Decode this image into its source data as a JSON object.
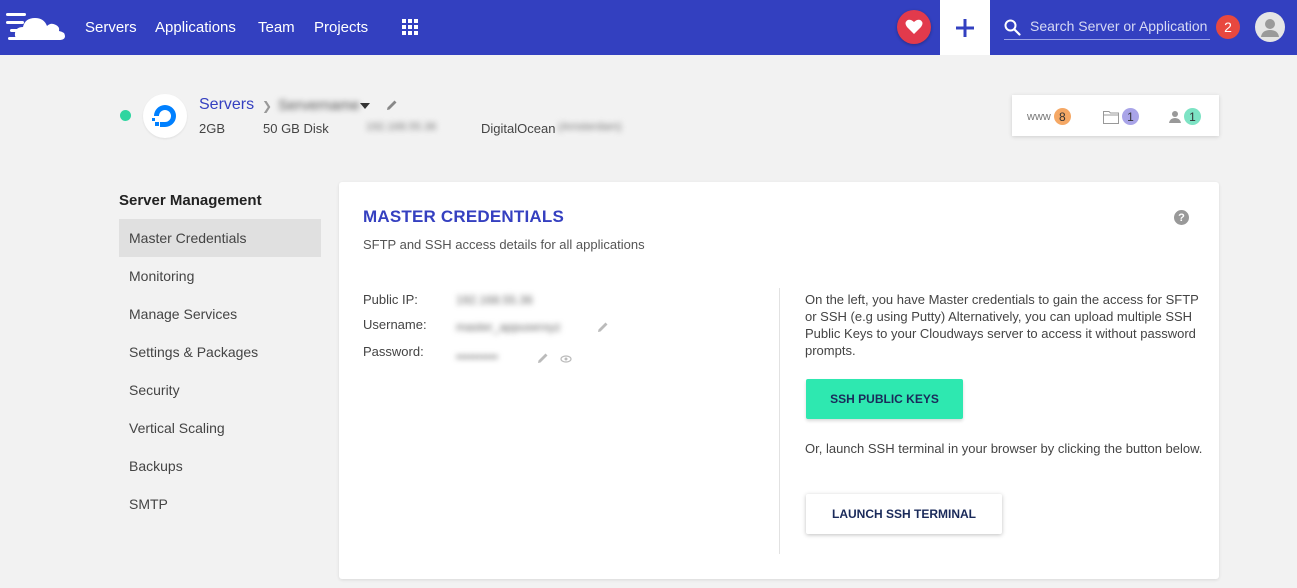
{
  "nav": {
    "items": [
      "Servers",
      "Applications",
      "Team",
      "Projects"
    ],
    "search_placeholder": "Search Server or Application",
    "notification_count": "2"
  },
  "server": {
    "breadcrumb_root": "Servers",
    "name": "Servername",
    "size": "2GB",
    "disk": "50 GB Disk",
    "ip": "192.168.55.36",
    "provider": "DigitalOcean",
    "location": "(Amsterdam)",
    "status_color": "#2ed5a0"
  },
  "stats": {
    "www_label": "www",
    "www_count": "8",
    "folders_count": "1",
    "users_count": "1"
  },
  "sidebar": {
    "title": "Server Management",
    "items": [
      "Master Credentials",
      "Monitoring",
      "Manage Services",
      "Settings & Packages",
      "Security",
      "Vertical Scaling",
      "Backups",
      "SMTP"
    ],
    "active": "Master Credentials"
  },
  "card": {
    "title": "MASTER CREDENTIALS",
    "subtitle": "SFTP and SSH access details for all applications",
    "labels": {
      "public_ip": "Public IP:",
      "username": "Username:",
      "password": "Password:"
    },
    "values": {
      "public_ip": "192.168.55.36",
      "username": "master_appuserxyz",
      "password": "••••••••••"
    },
    "info": "On the left, you have Master credentials to gain the access for SFTP or SSH (e.g using Putty) Alternatively, you can upload multiple SSH Public Keys to your Cloudways server to access it without password prompts.",
    "ssh_keys_button": "SSH PUBLIC KEYS",
    "or_text": "Or, launch SSH terminal in your browser by clicking the button below.",
    "terminal_button": "LAUNCH SSH TERMINAL"
  },
  "colors": {
    "topbar": "#3340c0",
    "accent": "#3540c0",
    "primary_button": "#2ee8b0",
    "heart": "#e23a4c",
    "notification": "#e8483f"
  }
}
